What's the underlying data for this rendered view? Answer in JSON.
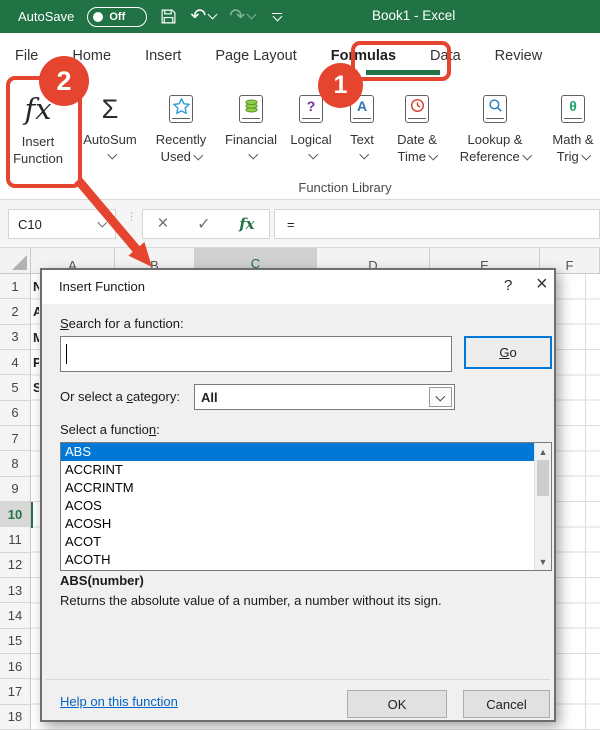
{
  "colors": {
    "excel_green": "#217346",
    "annotation_red": "#e5452f",
    "selection_blue": "#0078d7",
    "link_blue": "#0563c1"
  },
  "titlebar": {
    "autosave_label": "AutoSave",
    "autosave_state": "Off",
    "document_title": "Book1 - Excel"
  },
  "tabs": {
    "items": [
      "File",
      "Home",
      "Insert",
      "Page Layout",
      "Formulas",
      "Data",
      "Review"
    ],
    "active": "Formulas"
  },
  "ribbon": {
    "insert_function": {
      "icon_text": "fx",
      "label_line1": "Insert",
      "label_line2": "Function"
    },
    "buttons": [
      {
        "name": "autosum",
        "icon": "sigma",
        "label_lines": [
          "AutoSum"
        ]
      },
      {
        "name": "recently-used",
        "icon": "book-star",
        "label_lines": [
          "Recently",
          "Used"
        ]
      },
      {
        "name": "financial",
        "icon": "book-coins",
        "label_lines": [
          "Financial"
        ]
      },
      {
        "name": "logical",
        "icon": "book-question",
        "label_lines": [
          "Logical"
        ]
      },
      {
        "name": "text",
        "icon": "book-a",
        "label_lines": [
          "Text"
        ]
      },
      {
        "name": "date-time",
        "icon": "book-clock",
        "label_lines": [
          "Date &",
          "Time"
        ]
      },
      {
        "name": "lookup-reference",
        "icon": "book-search",
        "label_lines": [
          "Lookup &",
          "Reference"
        ]
      },
      {
        "name": "math-trig",
        "icon": "book-theta",
        "label_lines": [
          "Math &",
          "Trig"
        ]
      }
    ],
    "group_label": "Function Library"
  },
  "formula_bar": {
    "name_box_value": "C10",
    "cancel_glyph": "×",
    "enter_glyph": "✓",
    "fx_glyph": "fx",
    "formula_value": "="
  },
  "grid": {
    "column_headers": [
      "A",
      "B",
      "C",
      "D",
      "E",
      "F"
    ],
    "selected_column": "C",
    "row_count": 18,
    "selected_row": 10,
    "peek_cells": [
      "N",
      "A",
      "M",
      "P",
      "S"
    ]
  },
  "dialog": {
    "title": "Insert Function",
    "help_glyph": "?",
    "close_glyph": "×",
    "search_label": {
      "key": "S",
      "rest": "earch for a function:"
    },
    "search_value": "",
    "go_button": {
      "key": "G",
      "rest": "o"
    },
    "category_label": {
      "pre": "Or select a ",
      "key": "c",
      "rest": "ategory:"
    },
    "category_value": "All",
    "select_label": {
      "pre": "Select a functio",
      "key": "n",
      "rest": ":"
    },
    "functions": [
      "ABS",
      "ACCRINT",
      "ACCRINTM",
      "ACOS",
      "ACOSH",
      "ACOT",
      "ACOTH"
    ],
    "selected_function": "ABS",
    "signature": "ABS(number)",
    "description": "Returns the absolute value of a number, a number without its sign.",
    "help_link": "Help on this function",
    "ok_label": "OK",
    "cancel_label": "Cancel"
  },
  "annotations": {
    "badge_1": "1",
    "badge_2": "2"
  }
}
